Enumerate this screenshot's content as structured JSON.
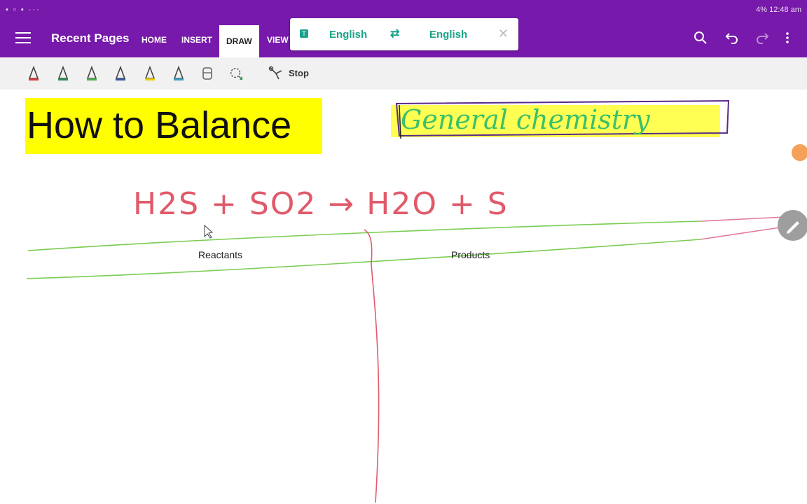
{
  "status_bar": {
    "left_icons": "▪ ▫ ▪ ···",
    "right_text": "4% 12:48 am"
  },
  "app_bar": {
    "recent_pages": "Recent Pages",
    "tabs": [
      {
        "label": "HOME"
      },
      {
        "label": "INSERT"
      },
      {
        "label": "DRAW"
      },
      {
        "label": "VIEW"
      }
    ],
    "active_tab": "DRAW"
  },
  "translator": {
    "from_lang": "English",
    "to_lang": "English",
    "close_glyph": "✕",
    "swap_glyph": "⇄"
  },
  "toolbar": {
    "stop_label": "Stop",
    "pen_colors": [
      "#d33b3b",
      "#2e8b57",
      "#4caf50",
      "#3b5998",
      "#f0d000",
      "#3aa0c0",
      "#777777"
    ]
  },
  "page": {
    "title": "How to Balance",
    "tag": "General chemistry",
    "equation": "H2S + SO2 → H2O + S",
    "reactants_label": "Reactants",
    "products_label": "Products"
  },
  "colors": {
    "accent": "#7719aa",
    "highlight": "#ffff00",
    "ink_red": "#e05a6a",
    "ink_green": "#7acc52",
    "ink_teal": "#1aa38a"
  }
}
